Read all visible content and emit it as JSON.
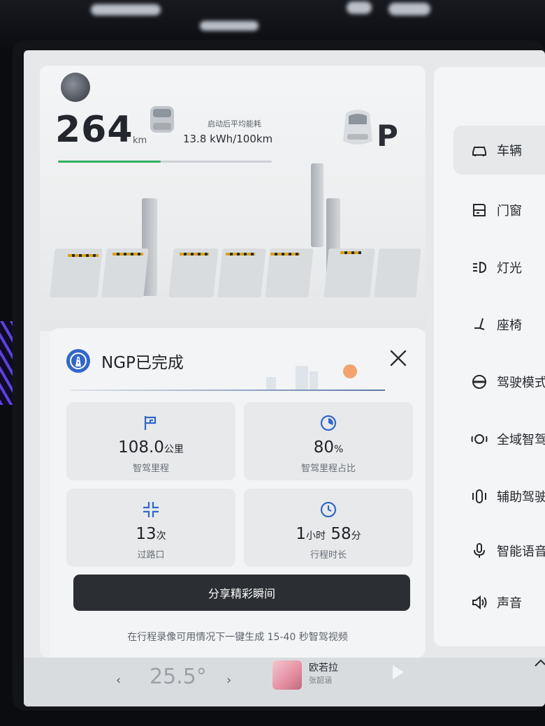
{
  "status": {
    "range_value": "264",
    "range_unit": "km",
    "energy_label": "启动后平均能耗",
    "energy_value": "13.8 kWh/100km",
    "range_progress_percent": 48,
    "gear": "P"
  },
  "ngp": {
    "title": "NGP已完成",
    "stats": [
      {
        "icon": "flag-icon",
        "value": "108.0",
        "unit": "公里",
        "label": "智驾里程"
      },
      {
        "icon": "pie-percent-icon",
        "value": "80",
        "unit": "%",
        "label": "智驾里程占比"
      },
      {
        "icon": "intersection-icon",
        "value": "13",
        "unit": "次",
        "label": "过路口"
      },
      {
        "icon": "clock-icon",
        "value_h": "1",
        "unit_h": "小时",
        "value_m": "58",
        "unit_m": "分",
        "label": "行程时长"
      }
    ],
    "share_label": "分享精彩瞬间",
    "footnote": "在行程录像可用情况下一键生成 15-40 秒智驾视频"
  },
  "menu": {
    "items": [
      {
        "label": "车辆",
        "icon": "car-icon",
        "active": true
      },
      {
        "label": "门窗",
        "icon": "door-icon",
        "active": false
      },
      {
        "label": "灯光",
        "icon": "headlight-icon",
        "active": false
      },
      {
        "label": "座椅",
        "icon": "seat-icon",
        "active": false
      },
      {
        "label": "驾驶模式",
        "icon": "steering-wheel-icon",
        "active": false
      },
      {
        "label": "全域智驾",
        "icon": "smart-drive-icon",
        "active": false
      },
      {
        "label": "辅助驾驶",
        "icon": "assist-drive-icon",
        "active": false
      },
      {
        "label": "智能语音",
        "icon": "microphone-icon",
        "active": false
      },
      {
        "label": "声音",
        "icon": "speaker-icon",
        "active": false
      }
    ]
  },
  "bottom_bar": {
    "temp_left": "‹",
    "temperature": "25.5°",
    "temp_right": "›",
    "song": "欧若拉",
    "artist": "张韶涵"
  },
  "colors": {
    "accent_green": "#2fae61",
    "ngp_blue": "#3266c9",
    "button_dark": "#2b2e32"
  }
}
